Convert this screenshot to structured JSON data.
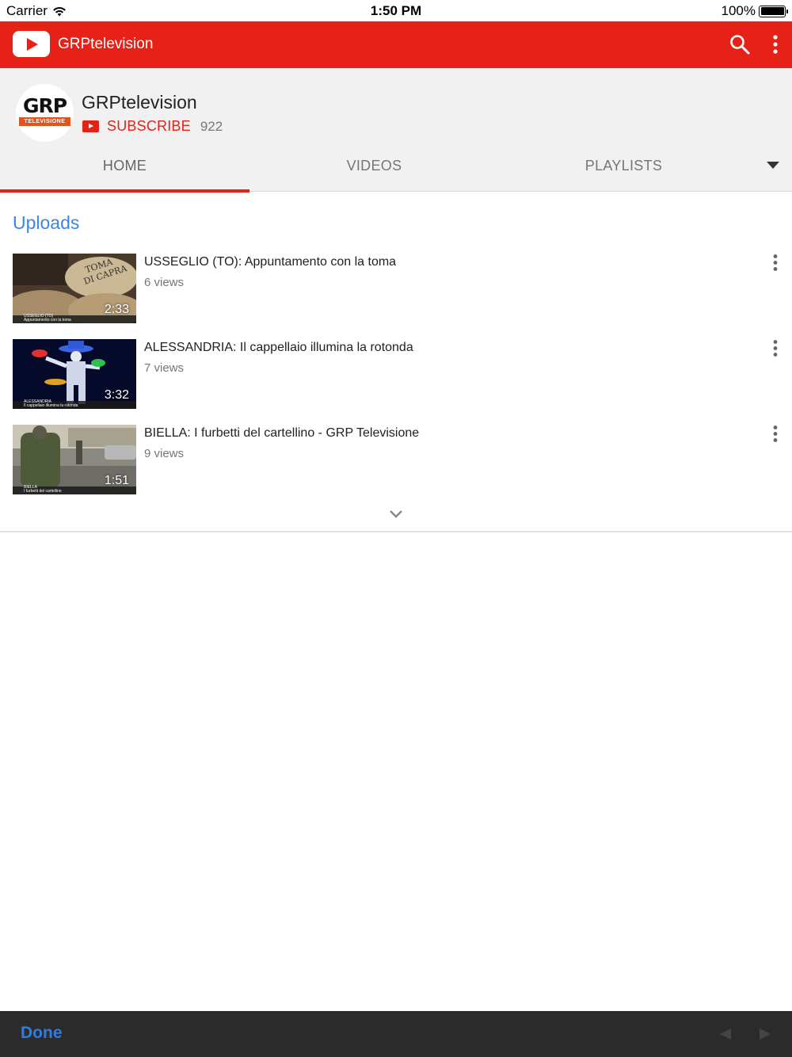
{
  "status_bar": {
    "carrier": "Carrier",
    "time": "1:50 PM",
    "battery": "100%"
  },
  "app_bar": {
    "title": "GRPtelevision",
    "icons": [
      "youtube-logo-icon",
      "search-icon",
      "more-vert-icon"
    ]
  },
  "channel": {
    "avatar_text": "GRP",
    "avatar_subtext": "TELEVISIONE",
    "name": "GRPtelevision",
    "subscribe_label": "SUBSCRIBE",
    "subscriber_count": "922"
  },
  "tabs": [
    {
      "label": "HOME",
      "active": true
    },
    {
      "label": "VIDEOS",
      "active": false
    },
    {
      "label": "PLAYLISTS",
      "active": false
    }
  ],
  "uploads": {
    "title": "Uploads",
    "videos": [
      {
        "title": "USSEGLIO (TO): Appuntamento con la toma",
        "views": "6 views",
        "duration": "2:33",
        "thumb_caption_1": "USSEGLIO (TO)",
        "thumb_caption_2": "Appuntamento con la toma"
      },
      {
        "title": "ALESSANDRIA: Il cappellaio illumina la rotonda",
        "views": "7 views",
        "duration": "3:32",
        "thumb_caption_1": "ALESSANDRIA",
        "thumb_caption_2": "Il cappellaio illumina la rotonda"
      },
      {
        "title": "BIELLA: I furbetti del cartellino - GRP Televisione",
        "views": "9 views",
        "duration": "1:51",
        "thumb_caption_1": "BIELLA",
        "thumb_caption_2": "I furbetti del cartellino"
      }
    ]
  },
  "toolbar": {
    "done_label": "Done"
  },
  "colors": {
    "youtube_red": "#e62117",
    "link_blue": "#3a87e6",
    "toolbar_bg": "#2b2b2b"
  }
}
